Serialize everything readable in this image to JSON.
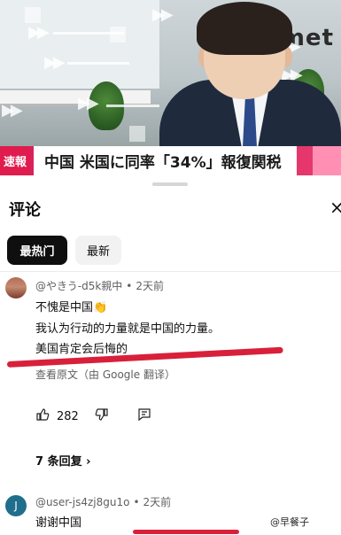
{
  "video": {
    "wall_text": "emet",
    "ticker": {
      "tag": "速報",
      "headline": "中国 米国に同率「34%」報復関税"
    }
  },
  "comments_panel": {
    "title": "评论",
    "close_icon": "×",
    "chips": [
      {
        "label": "最热门",
        "selected": true
      },
      {
        "label": "最新",
        "selected": false
      }
    ]
  },
  "comments": [
    {
      "author": "@やきう-d5k親中",
      "time": "2天前",
      "lines": [
        "不愧是中国",
        "我认为行动的力量就是中国的力量。",
        "美国肯定会后悔的"
      ],
      "emoji": "👏",
      "translate_link": "查看原文（由 Google 翻译）",
      "likes": "282",
      "replies": "7 条回复"
    },
    {
      "author": "@user-js4zj8gu1o",
      "time": "2天前",
      "avatar_letter": "J",
      "lines": [
        "谢谢中国"
      ]
    }
  ],
  "icons": {
    "like": "thumb-up-icon",
    "dislike": "thumb-down-icon",
    "reply": "comment-reply-icon",
    "more": "more-vert-icon",
    "chevron": "chevron-right-icon"
  },
  "watermark": "@早餐子",
  "colors": {
    "ticker_pink": "#e01b4d",
    "annotation_red": "#d8203a",
    "chip_selected": "#0f0f0f"
  }
}
